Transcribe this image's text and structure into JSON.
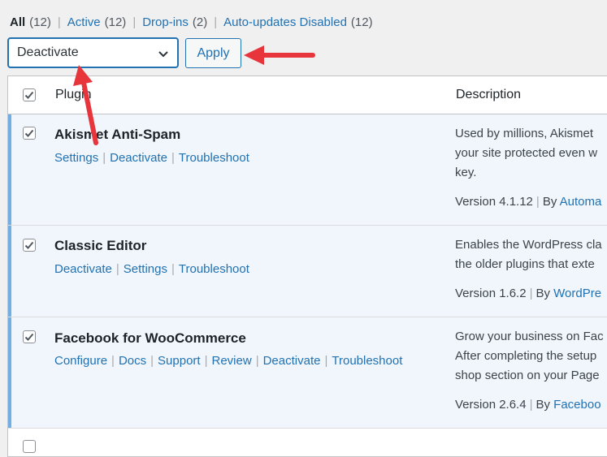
{
  "filters": [
    {
      "label": "All",
      "count": "(12)",
      "current": true
    },
    {
      "label": "Active",
      "count": "(12)",
      "current": false
    },
    {
      "label": "Drop-ins",
      "count": "(2)",
      "current": false
    },
    {
      "label": "Auto-updates Disabled",
      "count": "(12)",
      "current": false
    }
  ],
  "bulk_actions": {
    "selected": "Deactivate",
    "apply_label": "Apply"
  },
  "table": {
    "col_plugin": "Plugin",
    "col_description": "Description",
    "rows": [
      {
        "name": "Akismet Anti-Spam",
        "actions": [
          "Settings",
          "Deactivate",
          "Troubleshoot"
        ],
        "desc_lines": [
          "Used by millions, Akismet",
          "your site protected even w",
          "key."
        ],
        "version": "Version 4.1.12",
        "by": "By",
        "author": "Automa"
      },
      {
        "name": "Classic Editor",
        "actions": [
          "Deactivate",
          "Settings",
          "Troubleshoot"
        ],
        "desc_lines": [
          "Enables the WordPress cla",
          "the older plugins that exte"
        ],
        "version": "Version 1.6.2",
        "by": "By",
        "author": "WordPre"
      },
      {
        "name": "Facebook for WooCommerce",
        "actions": [
          "Configure",
          "Docs",
          "Support",
          "Review",
          "Deactivate",
          "Troubleshoot"
        ],
        "desc_lines": [
          "Grow your business on Fac",
          "After completing the setup",
          "shop section on your Page"
        ],
        "version": "Version 2.6.4",
        "by": "By",
        "author": "Faceboo"
      }
    ]
  },
  "colors": {
    "accent": "#2271b1",
    "arrow": "#e8353b",
    "active_row": "#f0f6fc",
    "active_bar": "#72aee6"
  }
}
